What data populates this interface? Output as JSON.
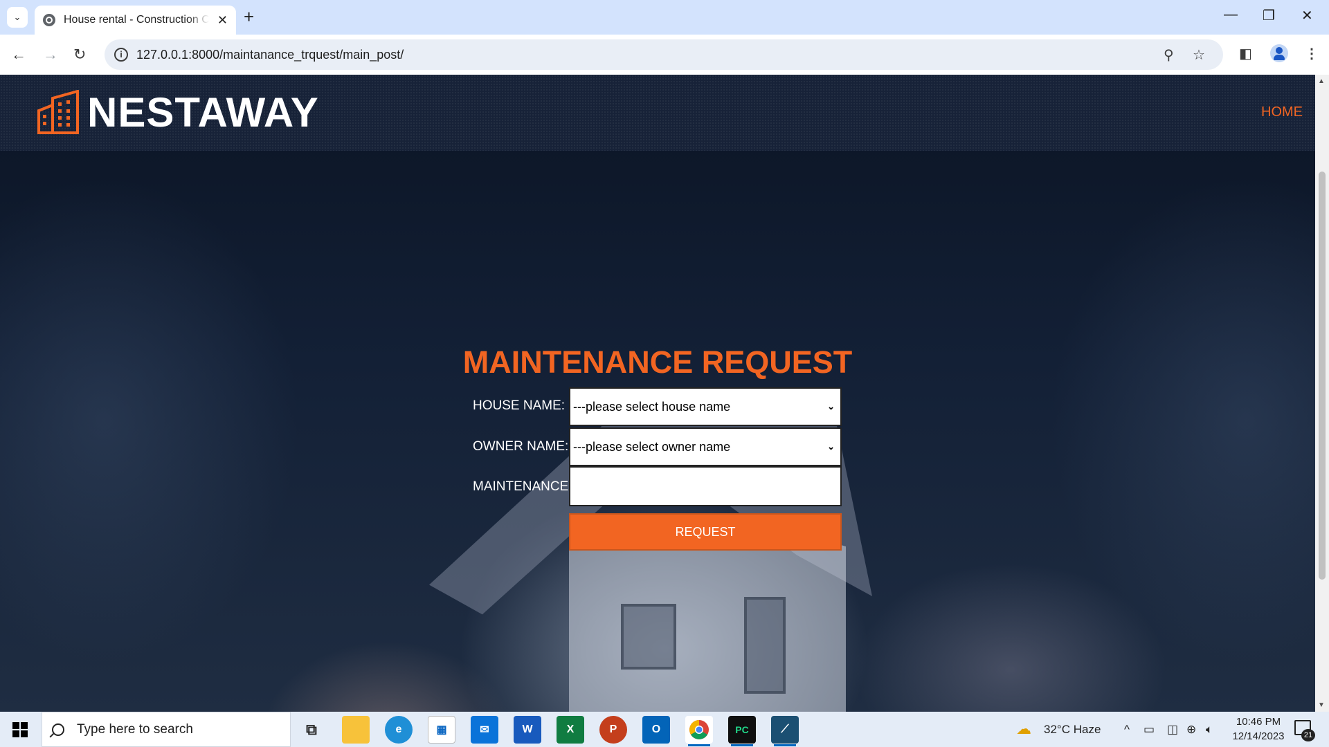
{
  "browser": {
    "tab_title": "House rental - Construction Company",
    "url": "127.0.0.1:8000/maintanance_trquest/main_post/"
  },
  "site": {
    "brand": "NESTAWAY",
    "nav_home": "HOME"
  },
  "form": {
    "title": "MAINTENANCE REQUEST",
    "house_label": "HOUSE NAME:",
    "house_selected": "---please select house name",
    "owner_label": "OWNER NAME:",
    "owner_selected": "---please select owner name",
    "maintenance_label": "MAINTENANCE:",
    "maintenance_value": "",
    "submit_label": "REQUEST"
  },
  "taskbar": {
    "search_placeholder": "Type here to search",
    "weather": "32°C  Haze",
    "time": "10:46 PM",
    "date": "12/14/2023",
    "notifications": "21"
  },
  "colors": {
    "accent": "#f26522",
    "header_bg": "#172238"
  }
}
